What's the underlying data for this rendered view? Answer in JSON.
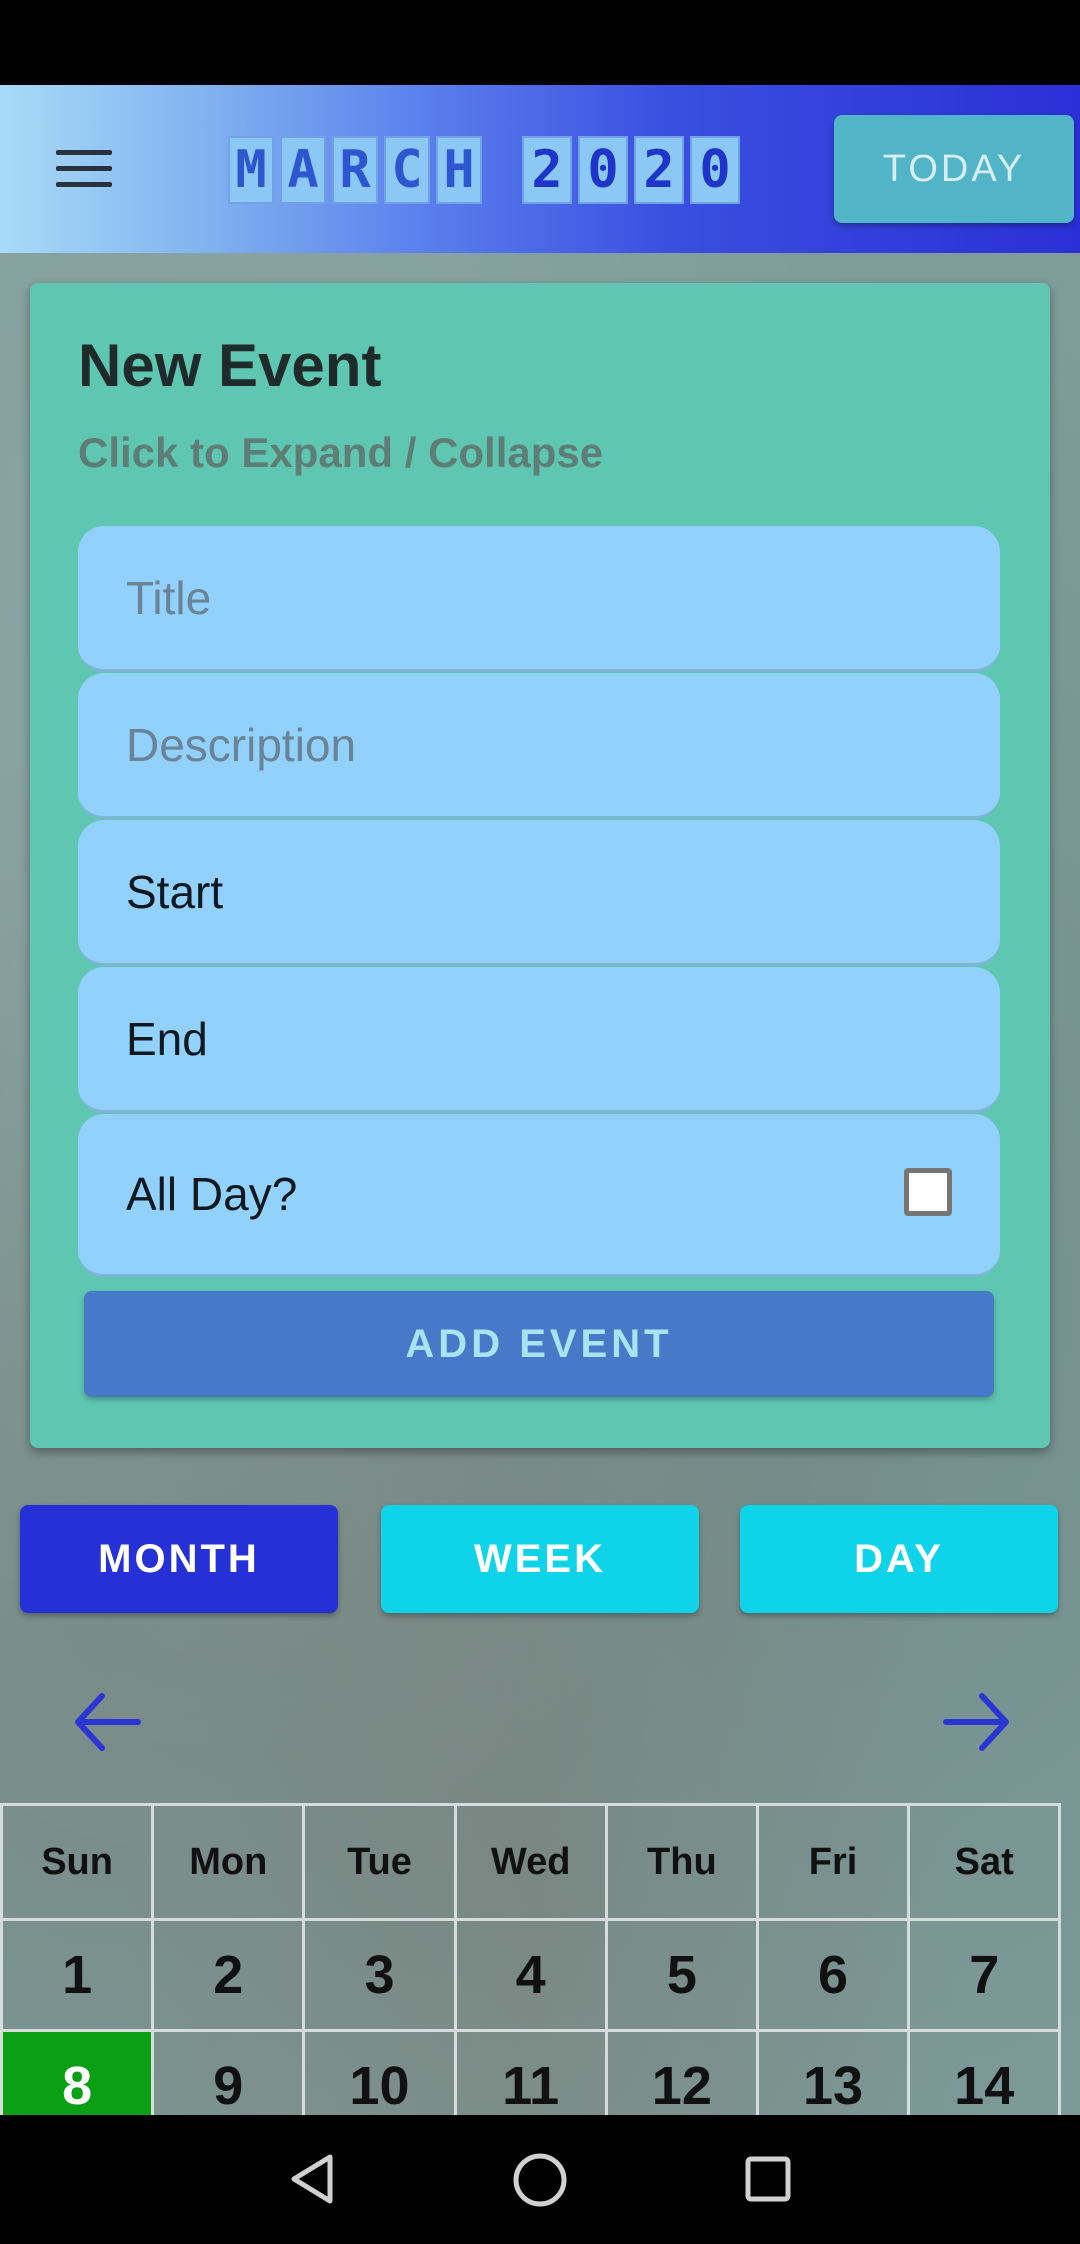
{
  "header": {
    "month_letters": [
      "M",
      "A",
      "R",
      "C",
      "H"
    ],
    "year_digits": [
      "2",
      "0",
      "2",
      "0"
    ],
    "today_label": "TODAY"
  },
  "event_card": {
    "title": "New Event",
    "subtitle": "Click to Expand / Collapse",
    "fields": {
      "title_placeholder": "Title",
      "description_placeholder": "Description",
      "start_label": "Start",
      "end_label": "End",
      "all_day_label": "All Day?"
    },
    "all_day_checked": false,
    "add_button": "ADD EVENT"
  },
  "view_buttons": {
    "month": "MONTH",
    "week": "WEEK",
    "day": "DAY",
    "selected": "month"
  },
  "calendar": {
    "weekdays": [
      "Sun",
      "Mon",
      "Tue",
      "Wed",
      "Thu",
      "Fri",
      "Sat"
    ],
    "weeks": [
      [
        "1",
        "2",
        "3",
        "4",
        "5",
        "6",
        "7"
      ],
      [
        "8",
        "9",
        "10",
        "11",
        "12",
        "13",
        "14"
      ]
    ],
    "today": "8"
  },
  "icons": {
    "menu": "menu-icon",
    "prev": "arrow-left-icon",
    "next": "arrow-right-icon",
    "nav_back": "back-triangle-icon",
    "nav_home": "home-circle-icon",
    "nav_recents": "recents-square-icon"
  },
  "colors": {
    "header_gradient_start": "#a8dbf7",
    "header_gradient_end": "#2a30d6",
    "card_bg": "#5fc7b1",
    "field_bg": "#92d1fb",
    "month_selected": "#2530d6",
    "view_unselected": "#0fd3e8",
    "today_cell": "#0a9f14"
  }
}
